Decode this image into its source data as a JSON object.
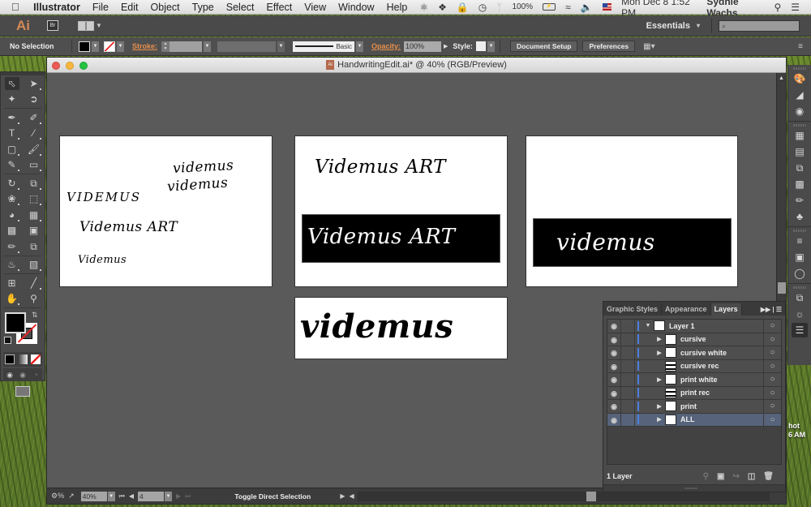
{
  "menubar": {
    "apple_icon": "apple-icon",
    "app_name": "Illustrator",
    "menus": [
      "File",
      "Edit",
      "Object",
      "Type",
      "Select",
      "Effect",
      "View",
      "Window",
      "Help"
    ],
    "status_icons": [
      "creative-cloud-icon",
      "dropbox-icon",
      "lock-icon",
      "time-machine-icon",
      "bluetooth-icon"
    ],
    "battery": "100%",
    "battery_glyph": "⚡",
    "date_time": "Mon Dec 8  1:52 PM",
    "user": "Sydnie Wachs"
  },
  "appbar": {
    "logo": "Ai",
    "bridge": "Br",
    "workspace": "Essentials",
    "search_placeholder": "⌕"
  },
  "controlbar": {
    "selection": "No Selection",
    "stroke_label": "Stroke:",
    "brush": "Basic",
    "opacity_label": "Opacity:",
    "opacity_value": "100%",
    "style_label": "Style:",
    "document_setup": "Document Setup",
    "preferences": "Preferences"
  },
  "document": {
    "title": "HandwritingEdit.ai* @ 40% (RGB/Preview)",
    "artboards": [
      {
        "texts": [
          "videmus",
          "videmus",
          "VIDEMUS",
          "Videmus ART",
          "Videmus"
        ]
      },
      {
        "texts": [
          "Videmus ART",
          "Videmus ART"
        ]
      },
      {
        "texts": [
          "videmus"
        ]
      },
      {
        "texts": [
          "videmus"
        ]
      }
    ]
  },
  "statusbar": {
    "zoom": "40%",
    "artboard_number": "4",
    "status_text": "Toggle Direct Selection"
  },
  "layers_panel": {
    "tabs": [
      "Graphic Styles",
      "Appearance",
      "Layers"
    ],
    "active_tab": "Layers",
    "layers": [
      {
        "name": "Layer 1",
        "expanded": true,
        "level": 0
      },
      {
        "name": "cursive",
        "expanded": false,
        "level": 1
      },
      {
        "name": "cursive white",
        "expanded": false,
        "level": 1
      },
      {
        "name": "cursive rec",
        "expanded": null,
        "level": 1
      },
      {
        "name": "print white",
        "expanded": false,
        "level": 1
      },
      {
        "name": "print rec",
        "expanded": null,
        "level": 1
      },
      {
        "name": "print",
        "expanded": false,
        "level": 1
      },
      {
        "name": "ALL",
        "expanded": false,
        "level": 1,
        "selected": true
      }
    ],
    "footer_count": "1 Layer"
  },
  "desktop": {
    "partial_text_1": "hot",
    "partial_text_2": "6 AM"
  },
  "colors": {
    "layer_color": "#4a7fe0",
    "accent_orange": "#e8904c",
    "selected_row": "#56637a"
  }
}
